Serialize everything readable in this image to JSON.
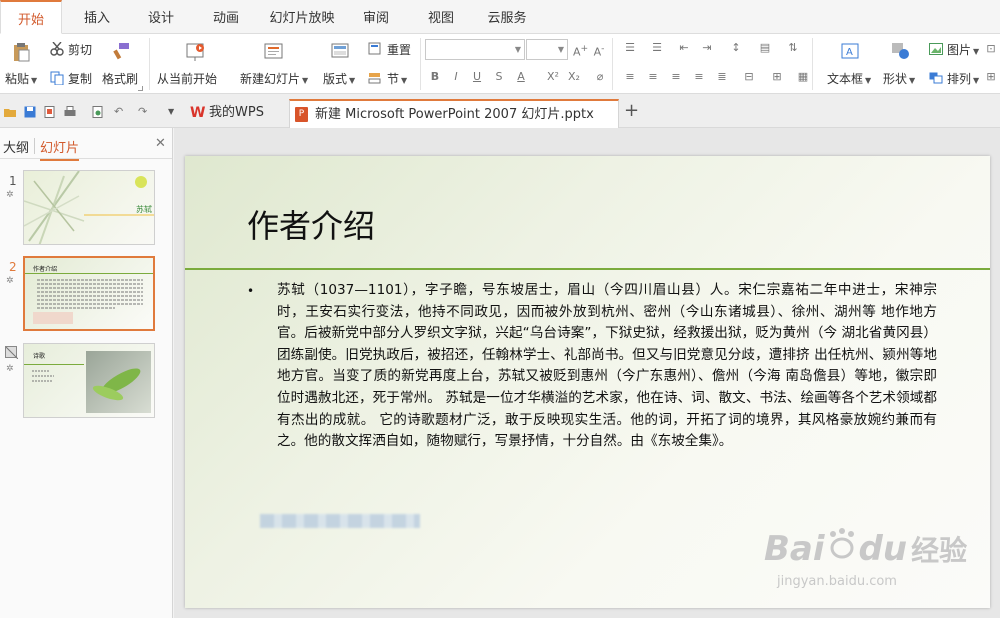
{
  "menu": {
    "tabs": [
      "开始",
      "插入",
      "设计",
      "动画",
      "幻灯片放映",
      "审阅",
      "视图",
      "云服务"
    ],
    "active": "开始"
  },
  "ribbon": {
    "paste": "粘贴",
    "cut": "剪切",
    "copy": "复制",
    "format_painter": "格式刷",
    "from_current": "从当前开始",
    "new_slide": "新建幻灯片",
    "layout": "版式",
    "reset": "重置",
    "section": "节",
    "textbox": "文本框",
    "shape": "形状",
    "picture": "图片",
    "arrange": "排列",
    "font_name": "",
    "font_size": ""
  },
  "quickbar": {
    "wps_tab": "我的WPS",
    "doc_tab": "新建 Microsoft PowerPoint 2007 幻灯片.pptx",
    "new_tab": "+"
  },
  "leftpanel": {
    "tab_outline": "大纲",
    "tab_slides": "幻灯片",
    "close": "✕",
    "thumbs": [
      {
        "num": "1",
        "title": "苏轼"
      },
      {
        "num": "2",
        "title": "作者介绍"
      },
      {
        "num": "3",
        "title": "诗歌"
      }
    ]
  },
  "slide": {
    "title": "作者介绍",
    "bullet": "•",
    "body": "苏轼（1037—1101），字子瞻，号东坡居士，眉山（今四川眉山县）人。宋仁宗嘉祐二年中进士，宋神宗时，王安石实行变法，他持不同政见，因而被外放到杭州、密州（今山东诸城县）、徐州、湖州等 地作地方官。后被新党中部分人罗织文字狱，兴起“乌台诗案”，下狱史狱，经救援出狱，贬为黄州（今 湖北省黄冈县）团练副使。旧党执政后，被招还，任翰林学士、礼部尚书。但又与旧党意见分歧，遭排挤 出任杭州、颍州等地地方官。当变了质的新党再度上台，苏轼又被贬到惠州（今广东惠州）、儋州（今海 南岛儋县）等地，徽宗即位时遇赦北还，死于常州。 苏轼是一位才华横溢的艺术家，他在诗、词、散文、书法、绘画等各个艺术领域都有杰出的成就。 它的诗歌题材广泛，敢于反映现实生活。他的词，开拓了词的境界，其风格豪放婉约兼而有之。他的散文挥洒自如，随物赋行，写景抒情，十分自然。由《东坡全集》。"
  },
  "watermark": {
    "brand": "Bai",
    "brand2": "du",
    "cn": "经验",
    "url": "jingyan.baidu.com"
  },
  "colors": {
    "accent": "#e07a3c",
    "line": "#7bab3d",
    "wps_red": "#d9342b"
  }
}
